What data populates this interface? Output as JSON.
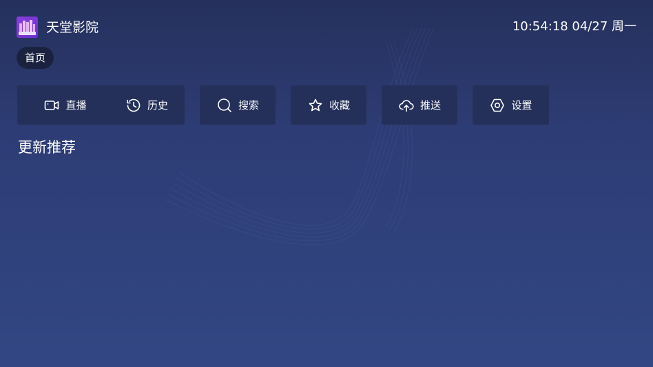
{
  "app": {
    "title": "天堂影院",
    "icon_name": "app-logo-icon",
    "accent_color": "#7b39dd"
  },
  "header": {
    "clock": "10:54:18 04/27 周一"
  },
  "nav": {
    "home_tab": "首页"
  },
  "actions": [
    {
      "id": "live",
      "label": "直播",
      "icon": "video-camera-icon"
    },
    {
      "id": "history",
      "label": "历史",
      "icon": "history-icon"
    },
    {
      "id": "search",
      "label": "搜索",
      "icon": "search-icon"
    },
    {
      "id": "favorite",
      "label": "收藏",
      "icon": "star-icon"
    },
    {
      "id": "push",
      "label": "推送",
      "icon": "cloud-upload-icon"
    },
    {
      "id": "settings",
      "label": "设置",
      "icon": "settings-icon"
    }
  ],
  "sections": {
    "recommend_title": "更新推荐"
  },
  "colors": {
    "background_top": "#25305c",
    "background_bottom": "#324784",
    "button_bg": "#24305a",
    "tab_bg": "#1a2240"
  }
}
